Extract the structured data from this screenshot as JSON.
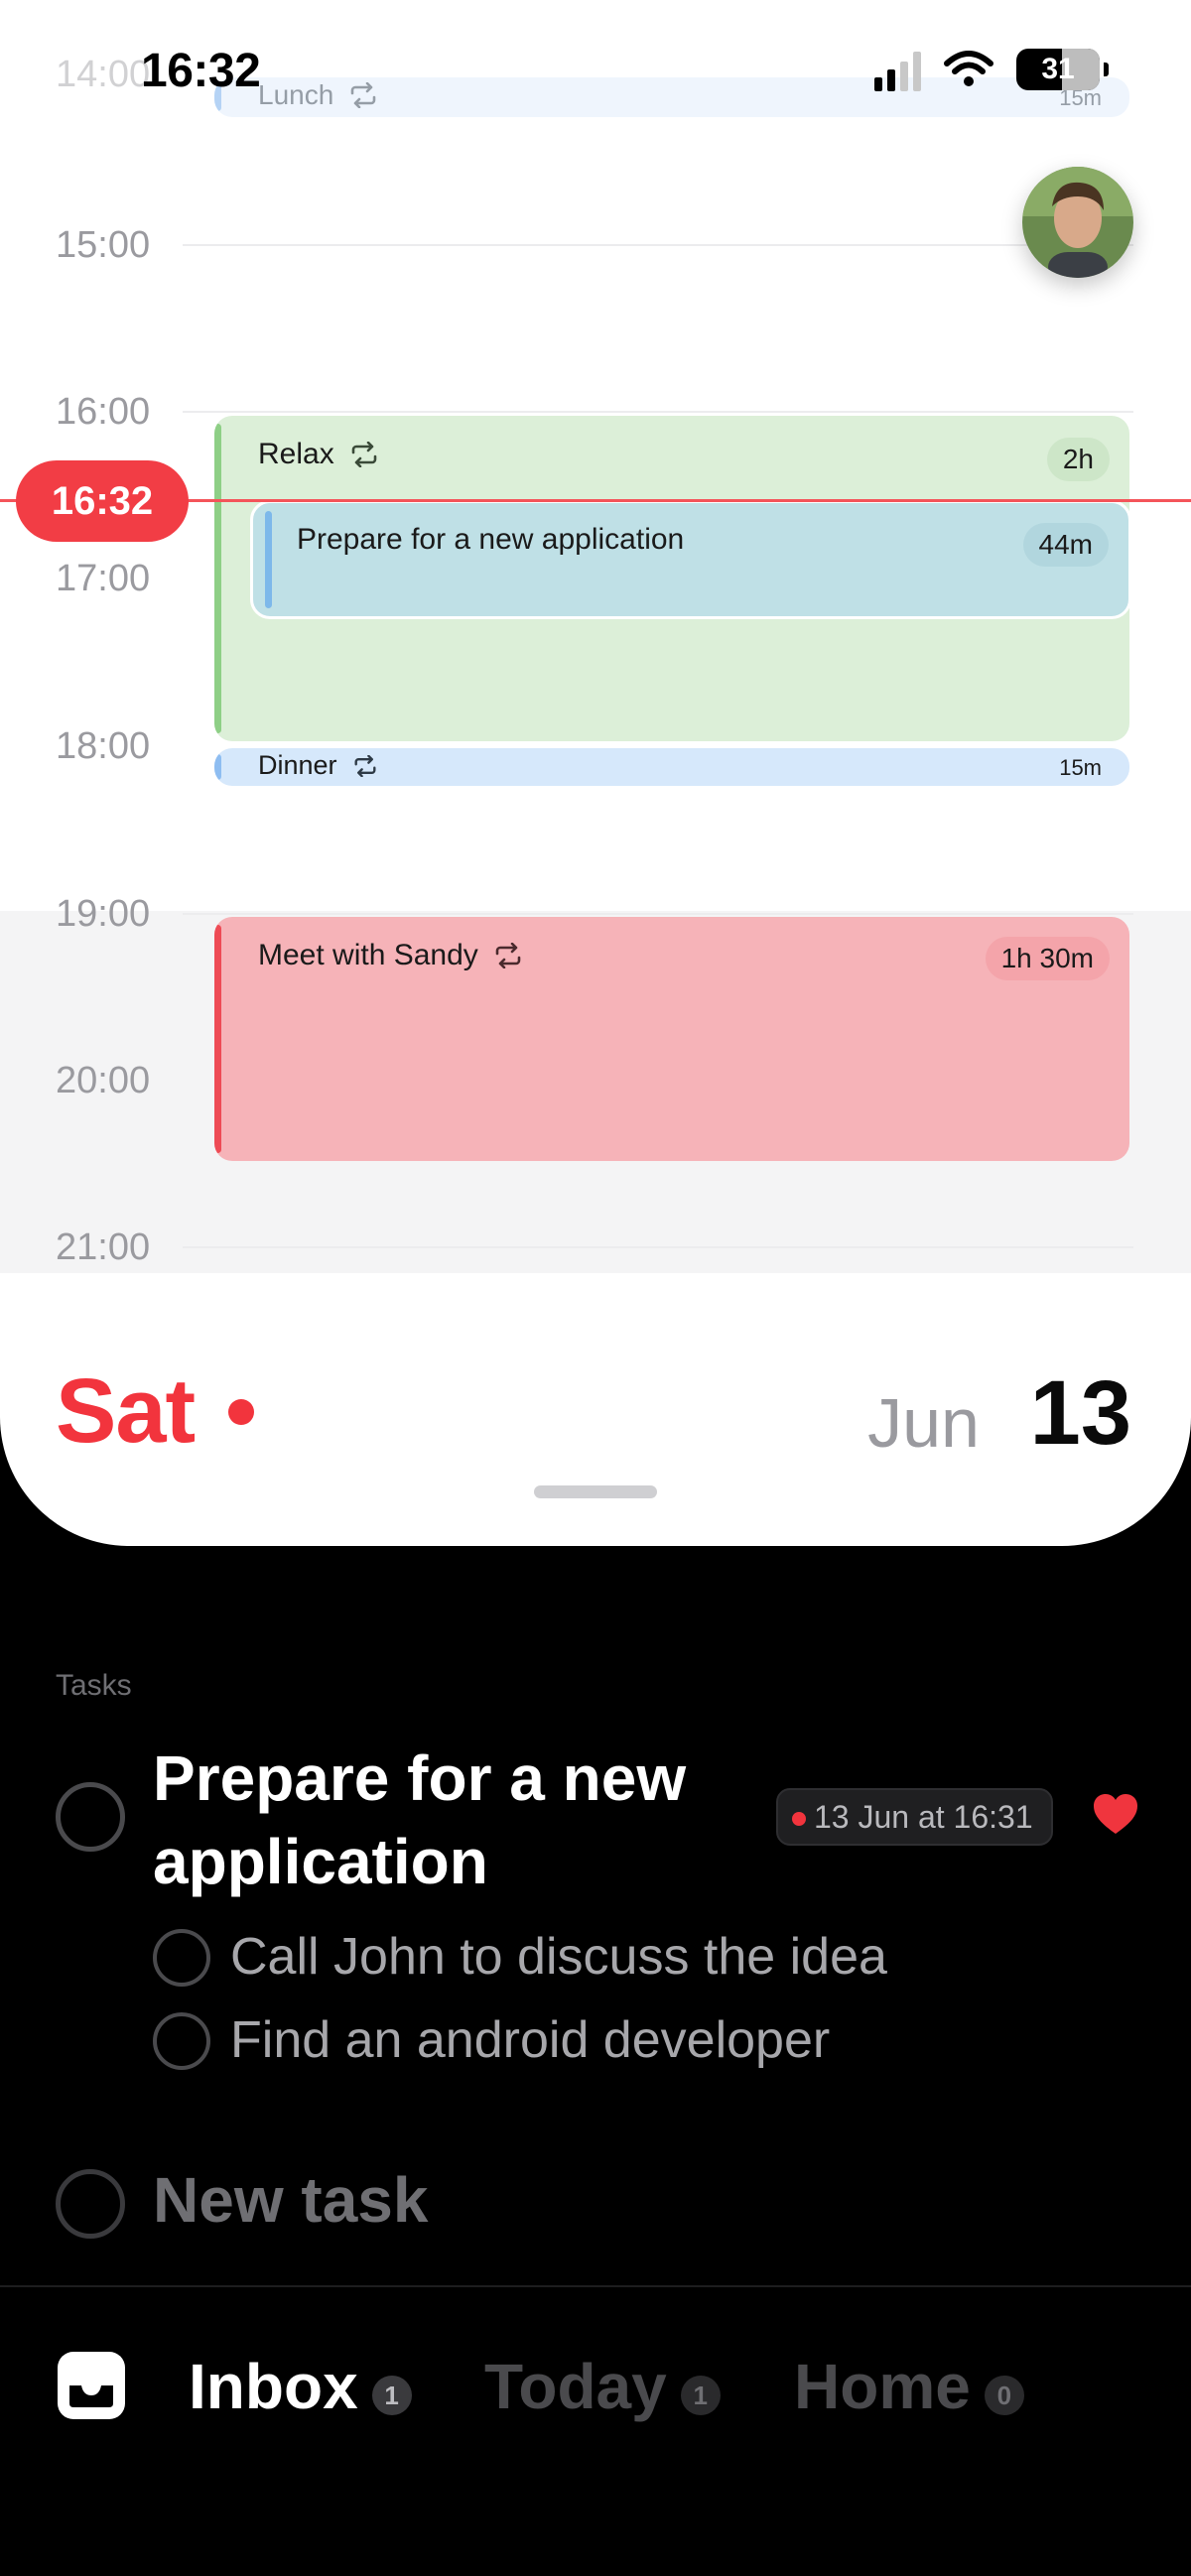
{
  "status_bar": {
    "time": "16:32",
    "battery": "31"
  },
  "calendar": {
    "hours": [
      "14:00",
      "15:00",
      "16:00",
      "17:00",
      "18:00",
      "19:00",
      "20:00",
      "21:00"
    ],
    "current_time": "16:32",
    "events": [
      {
        "title": "Lunch",
        "duration": "15m",
        "repeat": true,
        "color": "#dcebfc",
        "bar": "#8ebdf1"
      },
      {
        "title": "Relax",
        "duration": "2h",
        "repeat": true,
        "color": "#dcefd8",
        "bar": "#8ecf86"
      },
      {
        "title": "Prepare for a new application",
        "duration": "44m",
        "repeat": false,
        "color": "#bfe0e6",
        "bar": "#7db8ea"
      },
      {
        "title": "Dinner",
        "duration": "15m",
        "repeat": true,
        "color": "#d6e8fb",
        "bar": "#8ebdf1"
      },
      {
        "title": "Meet with Sandy",
        "duration": "1h 30m",
        "repeat": true,
        "color": "#f6b3b8",
        "bar": "#ee4b55"
      }
    ],
    "day_name": "Sat",
    "month": "Jun",
    "day_number": "13"
  },
  "tasks": {
    "section_label": "Tasks",
    "items": [
      {
        "title": "Prepare for a new application",
        "due": "13 Jun at 16:31",
        "favorite": true,
        "subtasks": [
          "Call John to discuss the idea",
          "Find an android developer"
        ]
      }
    ],
    "new_task_placeholder": "New task"
  },
  "tab_bar": {
    "tabs": [
      {
        "label": "Inbox",
        "count": "1",
        "active": true
      },
      {
        "label": "Today",
        "count": "1",
        "active": false
      },
      {
        "label": "Home",
        "count": "0",
        "active": false
      }
    ]
  }
}
